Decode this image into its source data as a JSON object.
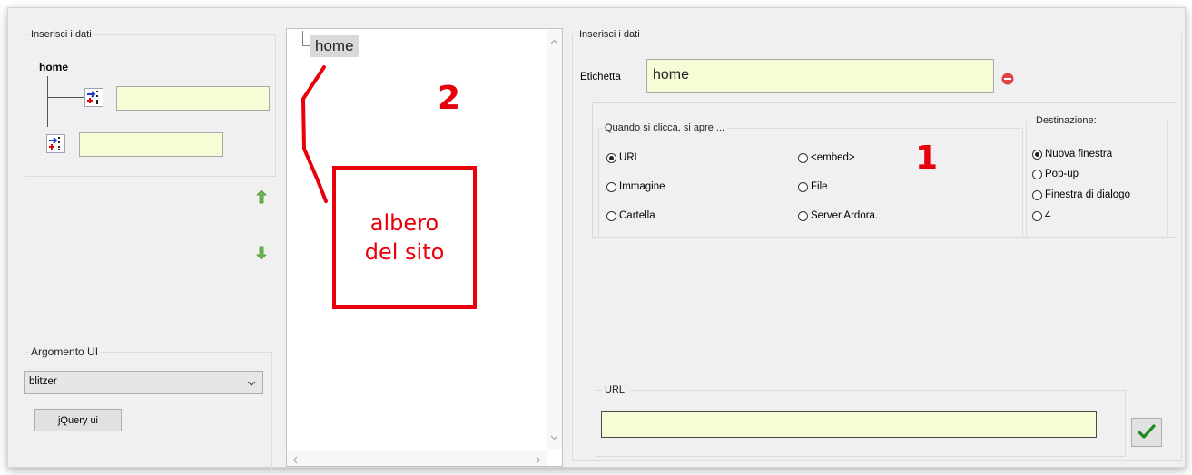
{
  "left_panel": {
    "group_title": "Inserisci i dati",
    "root_label": "home",
    "child_input_value": "",
    "sibling_input_value": ""
  },
  "theme_panel": {
    "group_title": "Argomento UI",
    "selected_theme": "blitzer",
    "jquery_button": "jQuery ui"
  },
  "tree_panel": {
    "node_label": "home"
  },
  "annotations": {
    "arrow_box_text_line1": "albero",
    "arrow_box_text_line2": "del sito",
    "number_2": "2",
    "number_1": "1",
    "color": "#e8000b"
  },
  "right_panel": {
    "group_title": "Inserisci i dati",
    "label_caption": "Etichetta",
    "label_value": "home",
    "click_group_title": "Quando si clicca, si apre ...",
    "options_left": [
      "URL",
      "Immagine",
      "Cartella"
    ],
    "options_right": [
      "<embed>",
      "File",
      "Server Ardora."
    ],
    "selected_option": "URL",
    "destination_title": "Destinazione:",
    "destinations": [
      "Nuova finestra",
      "Pop-up",
      "Finestra di dialogo",
      "4"
    ],
    "selected_destination": "Nuova finestra",
    "url_group_title": "URL:",
    "url_value": ""
  }
}
